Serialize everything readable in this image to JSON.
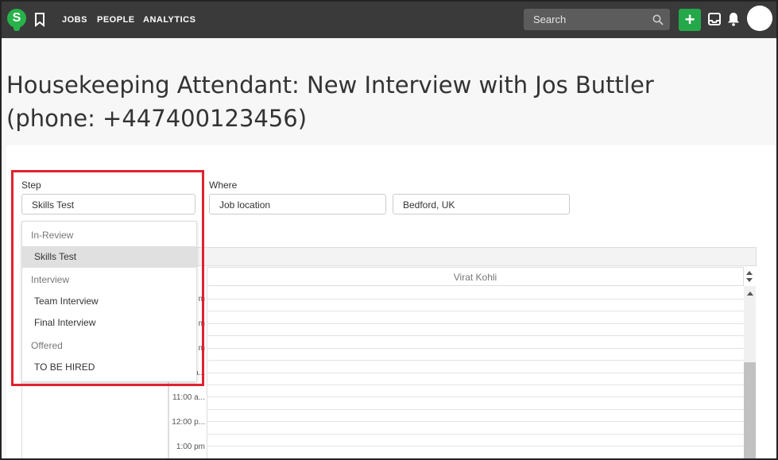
{
  "topbar": {
    "logo_letter": "S",
    "nav": [
      "JOBS",
      "PEOPLE",
      "ANALYTICS"
    ],
    "search_placeholder": "Search",
    "add_label": "+"
  },
  "page": {
    "title": "Housekeeping Attendant: New Interview with Jos Buttler (phone: +447400123456)"
  },
  "form": {
    "step_label": "Step",
    "step_value": "Skills Test",
    "where_label": "Where",
    "where_type": "Job location",
    "where_location": "Bedford, UK"
  },
  "dropdown": {
    "groups": [
      {
        "label": "In-Review",
        "items": [
          "Skills Test"
        ]
      },
      {
        "label": "Interview",
        "items": [
          "Team Interview",
          "Final Interview"
        ]
      },
      {
        "label": "Offered",
        "items": [
          "TO BE HIRED"
        ]
      }
    ],
    "selected": "Skills Test"
  },
  "calendar": {
    "column_header": "Virat Kohli",
    "times": [
      "m",
      "m",
      "m",
      "a...",
      "11:00 a...",
      "12:00 p...",
      "1:00 pm"
    ]
  },
  "colors": {
    "topbar": "#3a3a3a",
    "accent": "#25a84a",
    "highlight_box": "#e02230"
  }
}
